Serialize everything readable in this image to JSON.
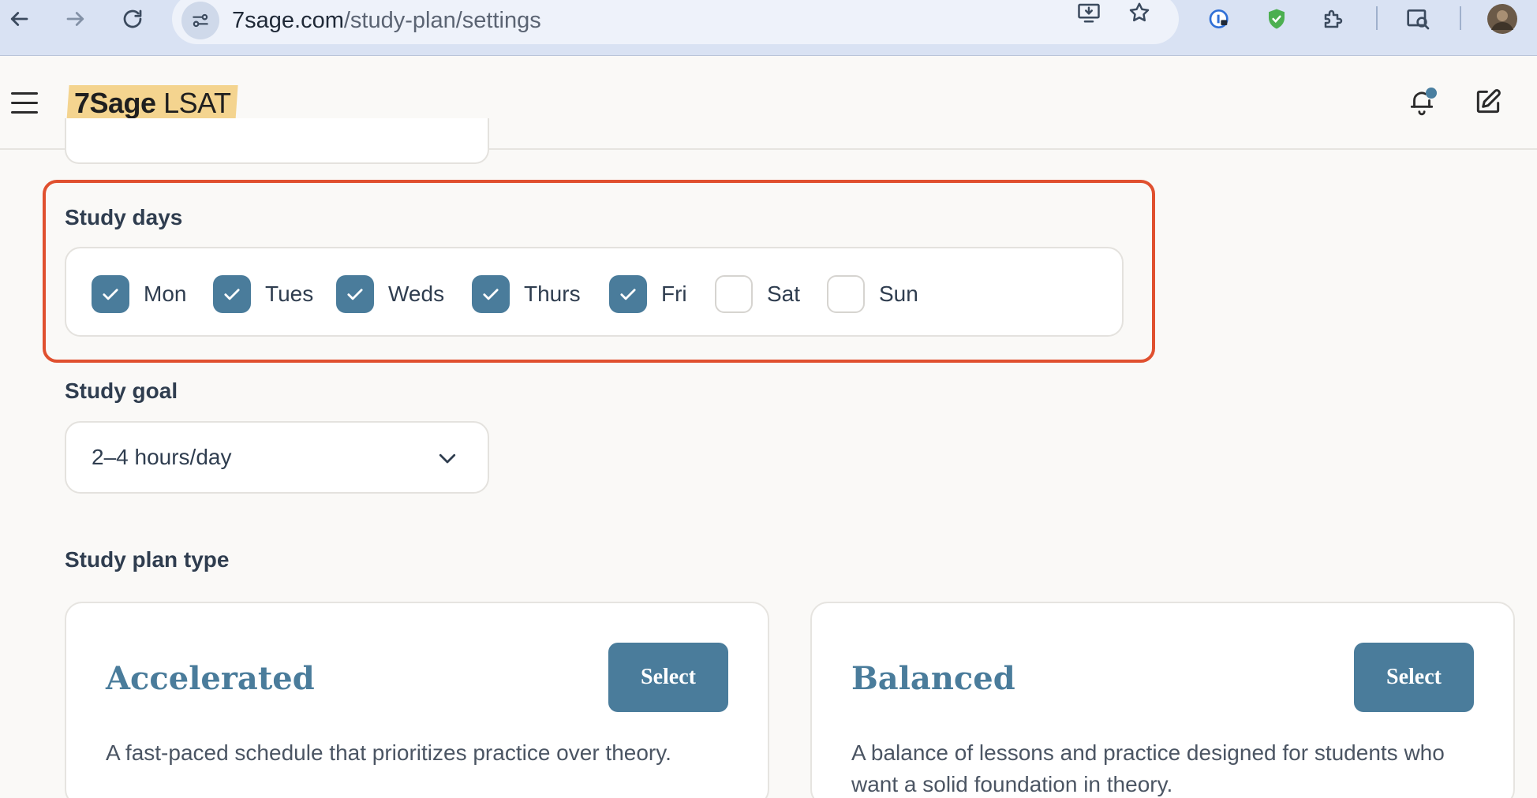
{
  "browser": {
    "url_domain": "7sage.com",
    "url_path": "/study-plan/settings"
  },
  "header": {
    "logo_brand": "7Sage",
    "logo_product": "LSAT"
  },
  "study_days": {
    "label": "Study days",
    "days": [
      {
        "label": "Mon",
        "checked": true
      },
      {
        "label": "Tues",
        "checked": true
      },
      {
        "label": "Weds",
        "checked": true
      },
      {
        "label": "Thurs",
        "checked": true
      },
      {
        "label": "Fri",
        "checked": true
      },
      {
        "label": "Sat",
        "checked": false
      },
      {
        "label": "Sun",
        "checked": false
      }
    ]
  },
  "study_goal": {
    "label": "Study goal",
    "value": "2–4 hours/day"
  },
  "plan_type": {
    "label": "Study plan type",
    "plans": [
      {
        "title": "Accelerated",
        "button": "Select",
        "description": "A fast-paced schedule that prioritizes practice over theory."
      },
      {
        "title": "Balanced",
        "button": "Select",
        "description": "A balance of lessons and practice designed for students who want a solid foundation in theory."
      }
    ]
  },
  "colors": {
    "accent": "#4a7c9b",
    "highlight_border": "#e0502f",
    "logo_bg": "#f4d48f",
    "browser_bar": "#d9e2f3"
  }
}
